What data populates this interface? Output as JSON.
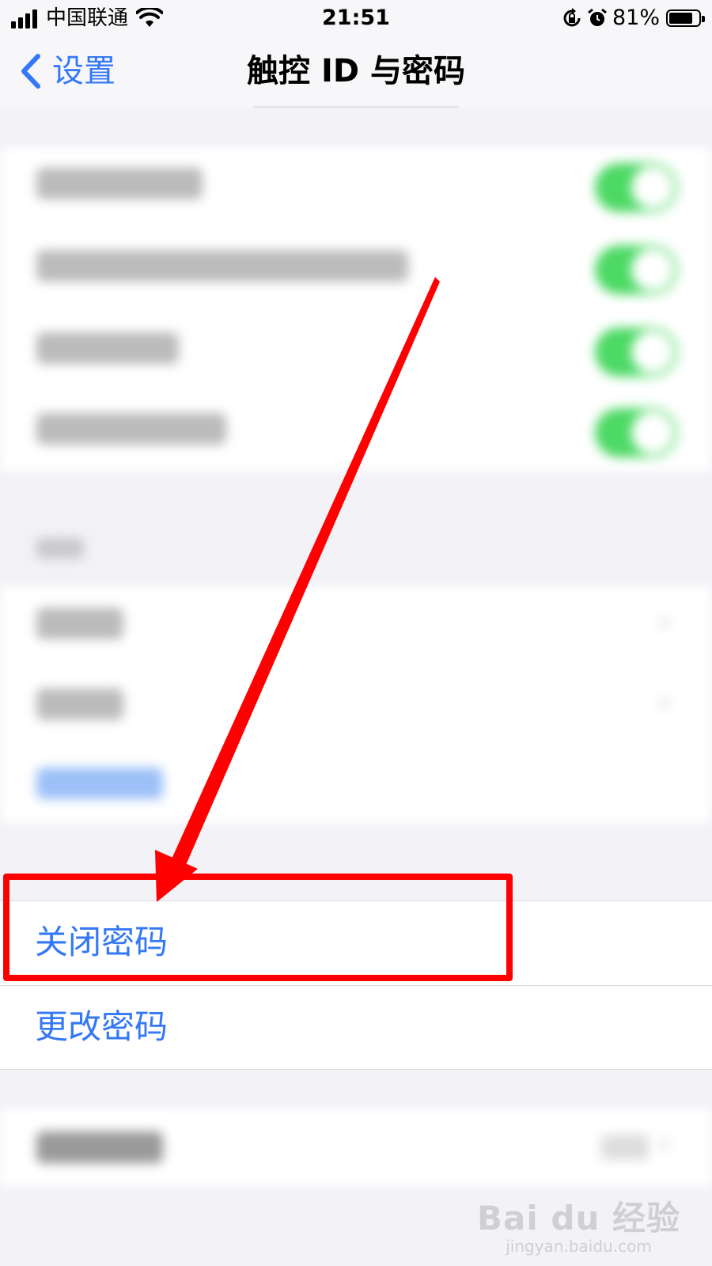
{
  "status_bar": {
    "carrier": "中国联通",
    "time": "21:51",
    "battery_percent": "81%",
    "battery_level": 0.81,
    "icons": [
      "signal-icon",
      "wifi-icon",
      "orientation-lock-icon",
      "alarm-icon",
      "battery-icon"
    ]
  },
  "nav": {
    "back_label": "设置",
    "title": "触控 ID 与密码"
  },
  "blurred_section": {
    "toggle_color": "#4cd964"
  },
  "passcode": {
    "items": [
      {
        "label": "关闭密码"
      },
      {
        "label": "更改密码"
      }
    ],
    "link_color": "#3478f6"
  },
  "annotation": {
    "color": "#ff0000"
  },
  "watermark": {
    "logo": "Bai du 经验",
    "url": "jingyan.baidu.com"
  }
}
